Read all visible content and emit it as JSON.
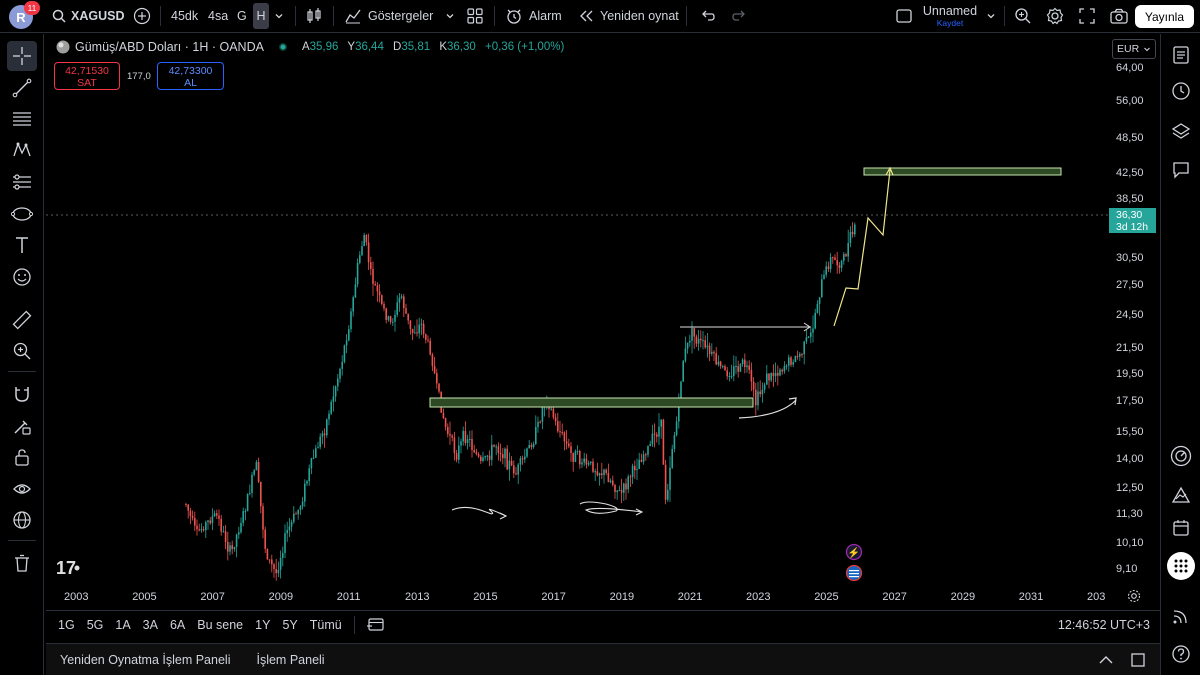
{
  "topbar": {
    "avatar_letter": "R",
    "notification_count": "11",
    "symbol": "XAGUSD",
    "intervals": [
      "45dk",
      "4sa",
      "G",
      "H"
    ],
    "active_interval": "H",
    "indicators_label": "Göstergeler",
    "alarm_label": "Alarm",
    "replay_label": "Yeniden oynat",
    "layout_name": "Unnamed",
    "layout_status": "Kaydet",
    "publish_label": "Yayınla"
  },
  "chart": {
    "title": "Gümüş/ABD Doları · 1H · OANDA",
    "ohlc": {
      "o_label": "A",
      "o": "35,96",
      "h_label": "Y",
      "h": "36,44",
      "l_label": "D",
      "l": "35,81",
      "c_label": "K",
      "c": "36,30",
      "change": "+0,36 (+1,00%)"
    },
    "sell_price": "42,71530",
    "sell_label": "SAT",
    "buy_price": "42,73300",
    "buy_label": "AL",
    "spread": "177,0",
    "currency": "EUR",
    "last_price": "36,30",
    "countdown": "3d 12h",
    "price_ticks": [
      "64,00",
      "56,00",
      "48,50",
      "42,50",
      "38,50",
      "30,50",
      "27,50",
      "24,50",
      "21,50",
      "19,50",
      "17,50",
      "15,50",
      "14,00",
      "12,50",
      "11,30",
      "10,10",
      "9,10"
    ],
    "year_ticks": [
      "2003",
      "2005",
      "2007",
      "2009",
      "2011",
      "2013",
      "2015",
      "2017",
      "2019",
      "2021",
      "2023",
      "2025",
      "2027",
      "2029",
      "2031",
      "203"
    ],
    "colors": {
      "up": "#26a69a",
      "down": "#ef5350",
      "zone_fill": "#2e4a25",
      "zone_border": "#c8e6b0",
      "projection": "#f0e68c"
    }
  },
  "rangebar": {
    "ranges": [
      "1G",
      "5G",
      "1A",
      "3A",
      "6A",
      "Bu sene",
      "1Y",
      "5Y",
      "Tümü"
    ],
    "clock": "12:46:52 UTC+3"
  },
  "bottompanel": {
    "tabs": [
      "Yeniden Oynatma İşlem Paneli",
      "İşlem Paneli"
    ]
  }
}
